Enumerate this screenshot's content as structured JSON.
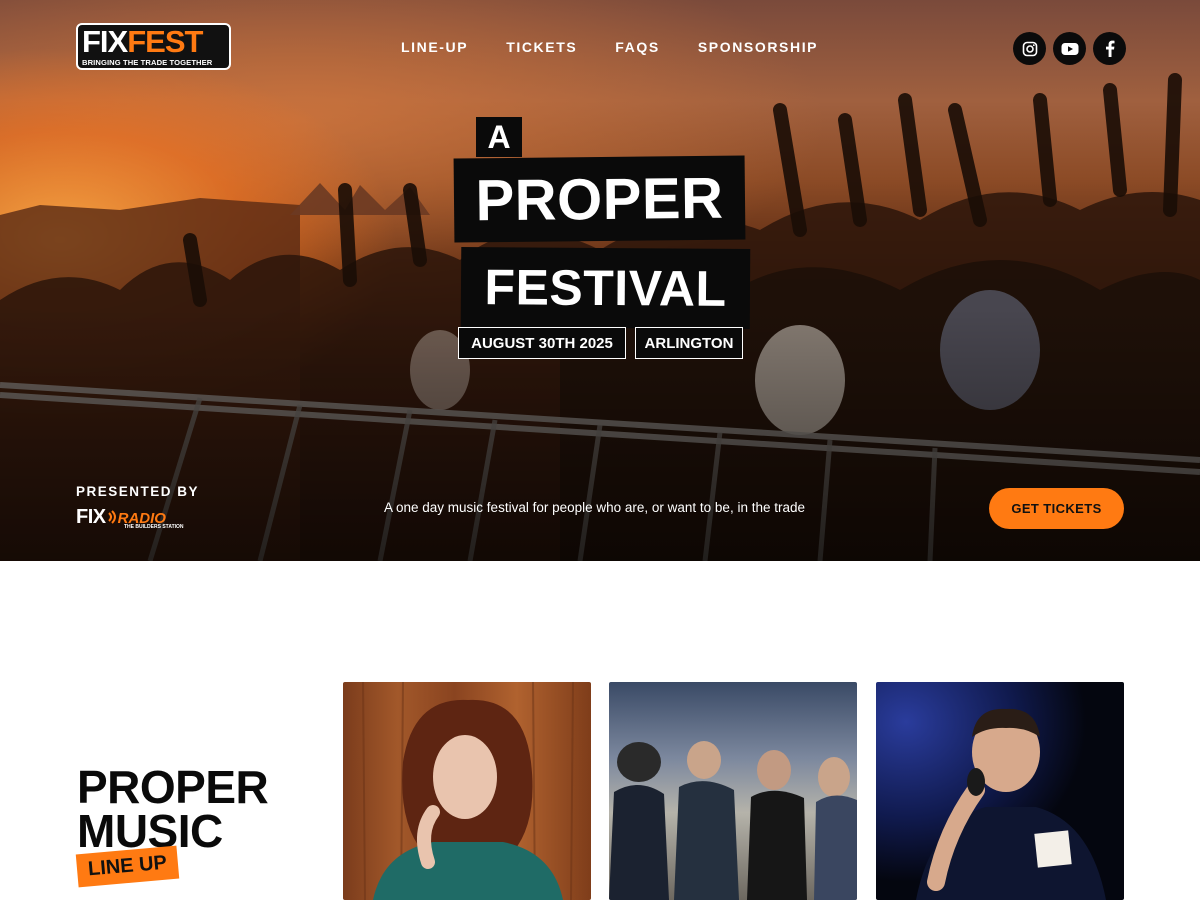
{
  "header": {
    "logo": {
      "word1": "FIX",
      "word2": "FEST",
      "tagline": "BRINGING THE TRADE TOGETHER"
    },
    "nav": [
      {
        "label": "LINE-UP"
      },
      {
        "label": "TICKETS"
      },
      {
        "label": "FAQS"
      },
      {
        "label": "SPONSORSHIP"
      }
    ],
    "socials": [
      {
        "icon": "instagram-icon"
      },
      {
        "icon": "youtube-icon"
      },
      {
        "icon": "facebook-icon"
      }
    ]
  },
  "hero": {
    "headline_a": "A",
    "headline_proper": "PROPER",
    "headline_festival": "FESTIVAL",
    "date": "AUGUST 30TH 2025",
    "location": "ARLINGTON",
    "presented_by": "PRESENTED BY",
    "sponsor": {
      "word1": "FIX",
      "word2": "RADIO",
      "tagline": "THE BUILDERS STATION"
    },
    "tagline": "A one day music festival for people who are, or want to be, in the trade",
    "cta_label": "GET TICKETS"
  },
  "lineup": {
    "title_line1": "PROPER",
    "title_line2": "MUSIC",
    "badge": "LINE UP",
    "cards": [
      {
        "name": "artist-card-1"
      },
      {
        "name": "artist-card-2"
      },
      {
        "name": "artist-card-3"
      }
    ]
  },
  "colors": {
    "accent": "#ff7a12",
    "dark": "#0a0a0a",
    "white": "#ffffff"
  }
}
